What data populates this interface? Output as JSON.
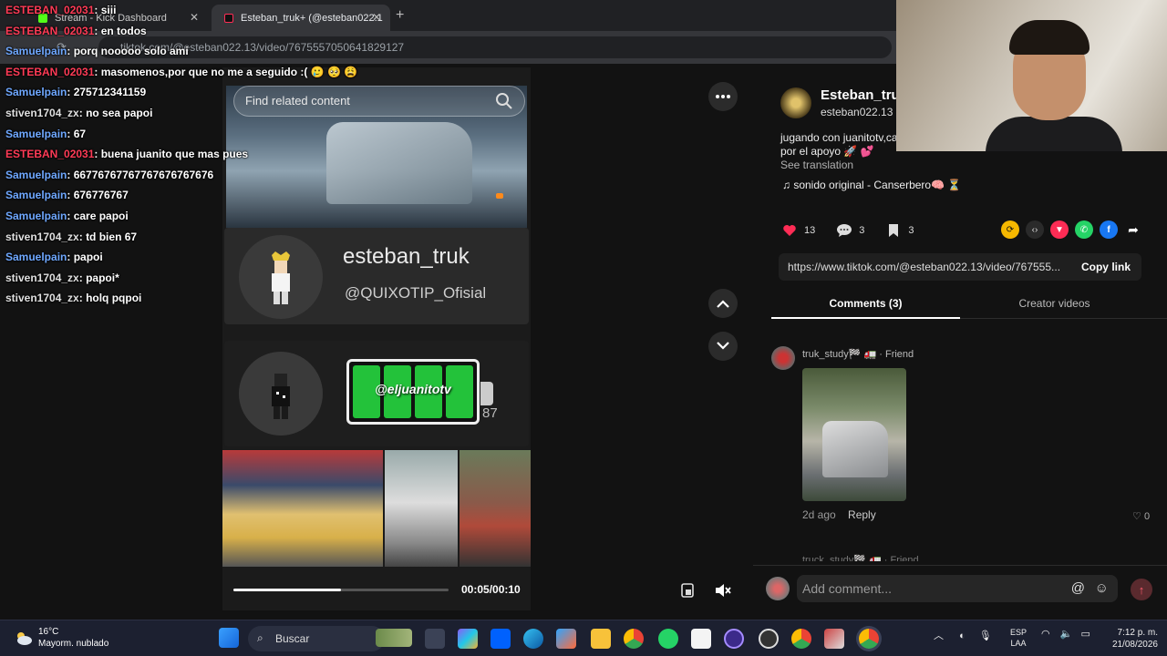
{
  "browser": {
    "tabs": [
      {
        "label": "Stream - Kick Dashboard",
        "close": "✕"
      },
      {
        "label": "Esteban_truk+ (@esteban022.1",
        "close": "✕"
      }
    ],
    "new_tab": "+",
    "url": "tiktok.com/@esteban022.13/video/7675557050641829127"
  },
  "chat": {
    "messages": [
      {
        "user": "ESTEBAN_02031",
        "text": ": siii",
        "color": "#ff3b56"
      },
      {
        "user": "ESTEBAN_02031",
        "text": ": en todos",
        "color": "#ff3b56"
      },
      {
        "user": "Samuelpain",
        "text": ": porq nooooo solo ami",
        "color": "#6fa8ff"
      },
      {
        "user": "ESTEBAN_02031",
        "text": ": masomenos,por que no me a seguido :( 🥲 🥺 😩",
        "color": "#ff3b56"
      },
      {
        "user": "Samuelpain",
        "text": ": 275712341159",
        "color": "#6fa8ff"
      },
      {
        "user": "stiven1704_zx",
        "text": ": no sea papoi",
        "color": "#e0e0e0"
      },
      {
        "user": "Samuelpain",
        "text": ": 67",
        "color": "#6fa8ff"
      },
      {
        "user": "ESTEBAN_02031",
        "text": ": buena juanito que mas pues",
        "color": "#ff3b56"
      },
      {
        "user": "Samuelpain",
        "text": ": 66776767767767676767676",
        "color": "#6fa8ff"
      },
      {
        "user": "Samuelpain",
        "text": ": 676776767",
        "color": "#6fa8ff"
      },
      {
        "user": "Samuelpain",
        "text": ": care papoi",
        "color": "#6fa8ff"
      },
      {
        "user": "stiven1704_zx",
        "text": ": td bien 67",
        "color": "#e0e0e0"
      },
      {
        "user": "Samuelpain",
        "text": ": papoi",
        "color": "#6fa8ff"
      },
      {
        "user": "stiven1704_zx",
        "text": ": papoi*",
        "color": "#e0e0e0"
      },
      {
        "user": "stiven1704_zx",
        "text": ": holq pqpoi",
        "color": "#e0e0e0"
      }
    ]
  },
  "video": {
    "search_placeholder": "Find related content",
    "overlay_name": "esteban_truk",
    "overlay_handle": "@QUIXOTIP_Ofisial",
    "battery_label": "@eljuanitotv",
    "battery_number": "87",
    "battery_level": 1.0,
    "time": "00:05/00:10",
    "progress": 0.5
  },
  "profile": {
    "name": "Esteban_truk",
    "handle": "esteban022.13",
    "description": "jugando con juanitotv,ca por el apoyo 🚀 💕",
    "see_translation": "See translation",
    "music": "♫  sonido original - Canserbero🧠 ⏳",
    "likes": "13",
    "comments": "3",
    "saves": "3",
    "link": "https://www.tiktok.com/@esteban022.13/video/767555...",
    "copy_link": "Copy link",
    "tab_comments": "Comments (3)",
    "tab_creator": "Creator videos"
  },
  "comment": {
    "user": "truk_study🏁 🚛 · Friend",
    "time": "2d ago",
    "reply": "Reply",
    "likes": "0",
    "next_user": "truck_study🏁 🚛 · Friend",
    "add_placeholder": "Add comment..."
  },
  "taskbar": {
    "temp": "16°C",
    "weather": "Mayorm. nublado",
    "search": "Buscar",
    "lang1": "ESP",
    "lang2": "LAA",
    "time": "7:12 p. m.",
    "date": "21/08/2026"
  },
  "colors": {
    "tiktok_red": "#fe2c55",
    "kick_green": "#53fc18",
    "battery_green": "#23c23a"
  }
}
